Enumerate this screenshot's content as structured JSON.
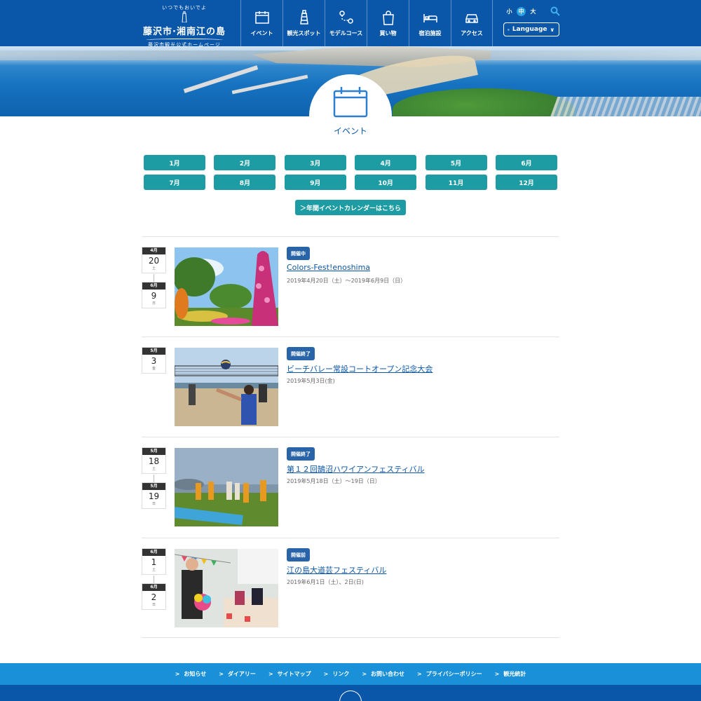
{
  "colors": {
    "primary": "#0a56a8",
    "teal": "#1e9ca3",
    "footer_nav": "#1a90d8",
    "badge": "#2a64a8"
  },
  "header": {
    "logo_arc": "いつでもおいでよ",
    "logo_title": "藤沢市·湘南江の島",
    "logo_sub": "藤沢市観光公式ホームページ",
    "nav": [
      {
        "label": "イベント",
        "icon": "calendar-icon"
      },
      {
        "label": "観光スポット",
        "icon": "lighthouse-icon"
      },
      {
        "label": "モデルコース",
        "icon": "route-icon"
      },
      {
        "label": "買い物",
        "icon": "shopping-bag-icon"
      },
      {
        "label": "宿泊施設",
        "icon": "bed-icon"
      },
      {
        "label": "アクセス",
        "icon": "car-icon"
      }
    ],
    "font_sizes": [
      "小",
      "中",
      "大"
    ],
    "language_label": "Language"
  },
  "section": {
    "title": "イベント"
  },
  "months": [
    "1月",
    "2月",
    "3月",
    "4月",
    "5月",
    "6月",
    "7月",
    "8月",
    "9月",
    "10月",
    "11月",
    "12月"
  ],
  "calendar_link": "＞年間イベントカレンダーはこちら",
  "events": [
    {
      "start": {
        "month": "4月",
        "day": "20",
        "weekday": "土"
      },
      "end": {
        "month": "6月",
        "day": "9",
        "weekday": "日"
      },
      "status": "開催中",
      "title": "Colors-Fest!enoshima",
      "date_text": "2019年4月20日（土）～2019年6月9日（日）"
    },
    {
      "start": {
        "month": "5月",
        "day": "3",
        "weekday": "金"
      },
      "status": "開催終了",
      "title": "ビーチバレー常設コートオープン記念大会",
      "date_text": "2019年5月3日(金)"
    },
    {
      "start": {
        "month": "5月",
        "day": "18",
        "weekday": "土"
      },
      "end": {
        "month": "5月",
        "day": "19",
        "weekday": "日"
      },
      "status": "開催終了",
      "title": "第１２回鵠沼ハワイアンフェスティバル",
      "date_text": "2019年5月18日（土）～19日（日）"
    },
    {
      "start": {
        "month": "6月",
        "day": "1",
        "weekday": "土"
      },
      "end": {
        "month": "6月",
        "day": "2",
        "weekday": "日"
      },
      "status": "開催前",
      "title": "江の島大道芸フェスティバル",
      "date_text": "2019年6月1日（土）、2日(日)"
    }
  ],
  "footer": {
    "links": [
      "お知らせ",
      "ダイアリー",
      "サイトマップ",
      "リンク",
      "お問い合わせ",
      "プライバシーポリシー",
      "観光統計"
    ]
  }
}
